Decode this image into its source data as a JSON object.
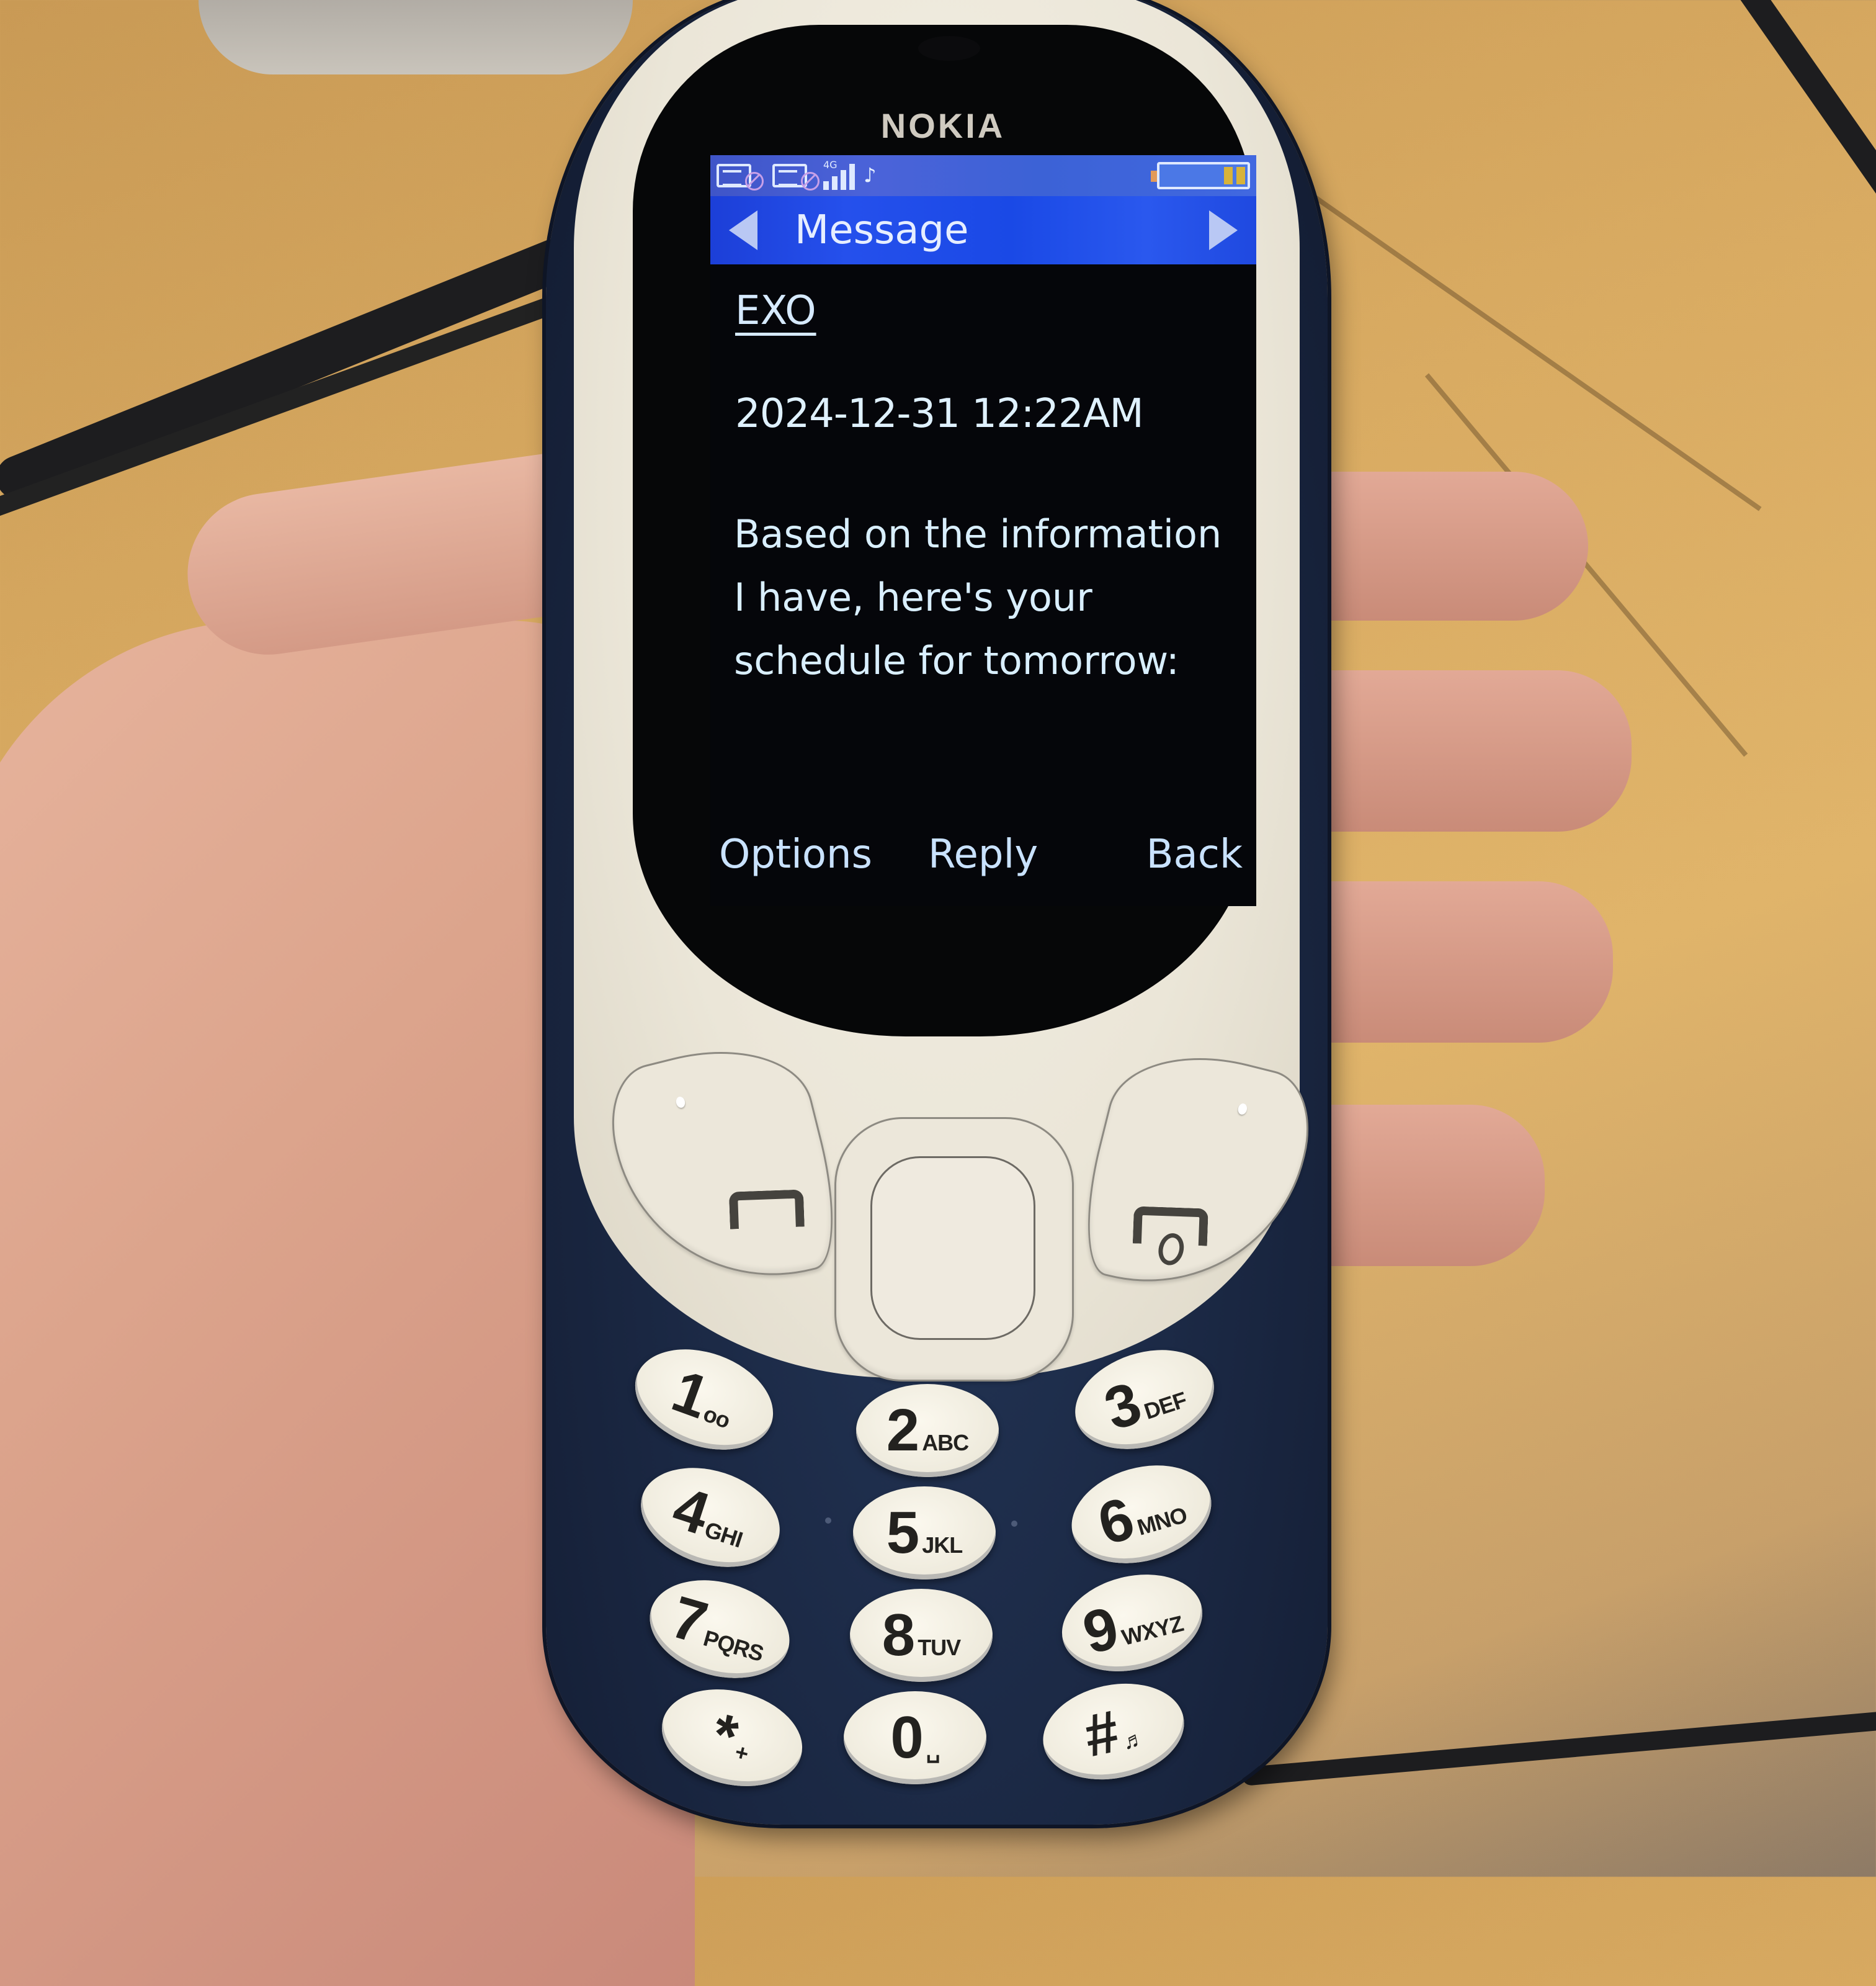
{
  "device": {
    "brand": "NOKIA",
    "body_color": "#1a2742",
    "faceplate_color": "#ebe6d8"
  },
  "status_bar": {
    "icons": [
      {
        "name": "sim1-icon",
        "state": "no-service"
      },
      {
        "name": "sim2-icon",
        "state": "no-service"
      },
      {
        "name": "signal-icon",
        "network": "4G",
        "bars": 4
      },
      {
        "name": "music-note-icon",
        "glyph": "♪"
      }
    ],
    "battery": {
      "level_bars": 2,
      "max_bars": 6
    }
  },
  "title_bar": {
    "title": "Message",
    "left_arrow": "previous-message",
    "right_arrow": "next-message",
    "color": "#2550ec"
  },
  "message": {
    "sender": "EXO",
    "datetime": "2024-12-31 12:22AM",
    "body": "Based on the information I have, here's your schedule for tomorrow:"
  },
  "softkeys": {
    "left": "Options",
    "middle": "Reply",
    "right": "Back"
  },
  "keypad": [
    {
      "num": "1",
      "letters": "oo"
    },
    {
      "num": "2",
      "letters": "ABC"
    },
    {
      "num": "3",
      "letters": "DEF"
    },
    {
      "num": "4",
      "letters": "GHI"
    },
    {
      "num": "5",
      "letters": "JKL"
    },
    {
      "num": "6",
      "letters": "MNO"
    },
    {
      "num": "7",
      "letters": "PQRS"
    },
    {
      "num": "8",
      "letters": "TUV"
    },
    {
      "num": "9",
      "letters": "WXYZ"
    },
    {
      "num": "*",
      "letters": "+"
    },
    {
      "num": "0",
      "letters": "␣"
    },
    {
      "num": "#",
      "letters": "♬"
    }
  ]
}
